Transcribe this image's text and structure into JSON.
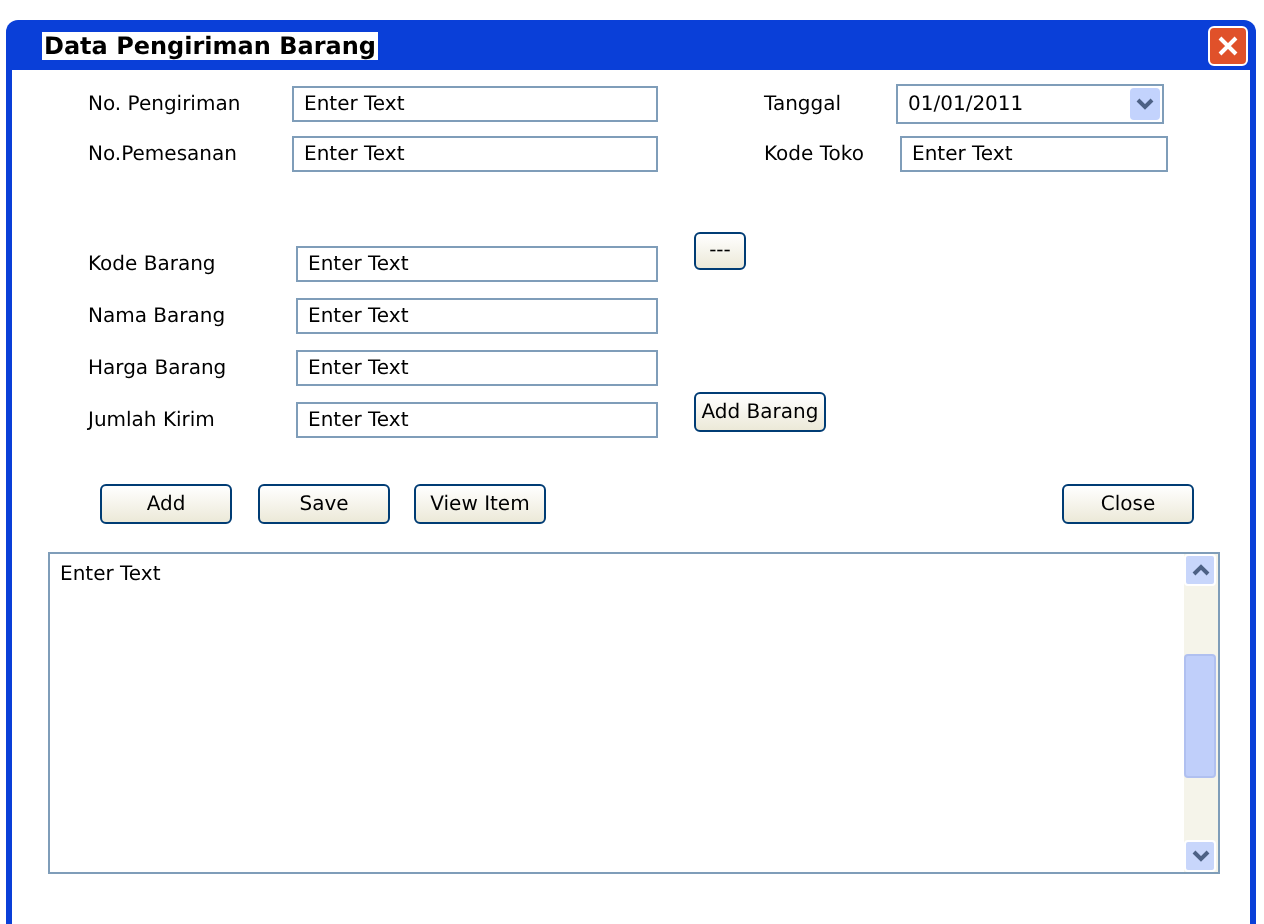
{
  "window": {
    "title": "Data Pengiriman Barang"
  },
  "header_fields": [
    {
      "label": "No. Pengiriman",
      "value": "Enter Text"
    },
    {
      "label": "No.Pemesanan",
      "value": "Enter Text"
    }
  ],
  "tanggal": {
    "label": "Tanggal",
    "value": "01/01/2011"
  },
  "kode_toko": {
    "label": "Kode Toko",
    "value": "Enter Text"
  },
  "item_fields": [
    {
      "label": "Kode Barang",
      "value": "Enter Text"
    },
    {
      "label": "Nama Barang",
      "value": "Enter Text"
    },
    {
      "label": "Harga Barang",
      "value": "Enter Text"
    },
    {
      "label": "Jumlah Kirim",
      "value": "Enter Text"
    }
  ],
  "browse_button": "---",
  "add_item_button": "Add Barang",
  "action_buttons": [
    "Add",
    "Save",
    "View Item"
  ],
  "close_button": "Close",
  "text_area": {
    "value": "Enter Text"
  }
}
